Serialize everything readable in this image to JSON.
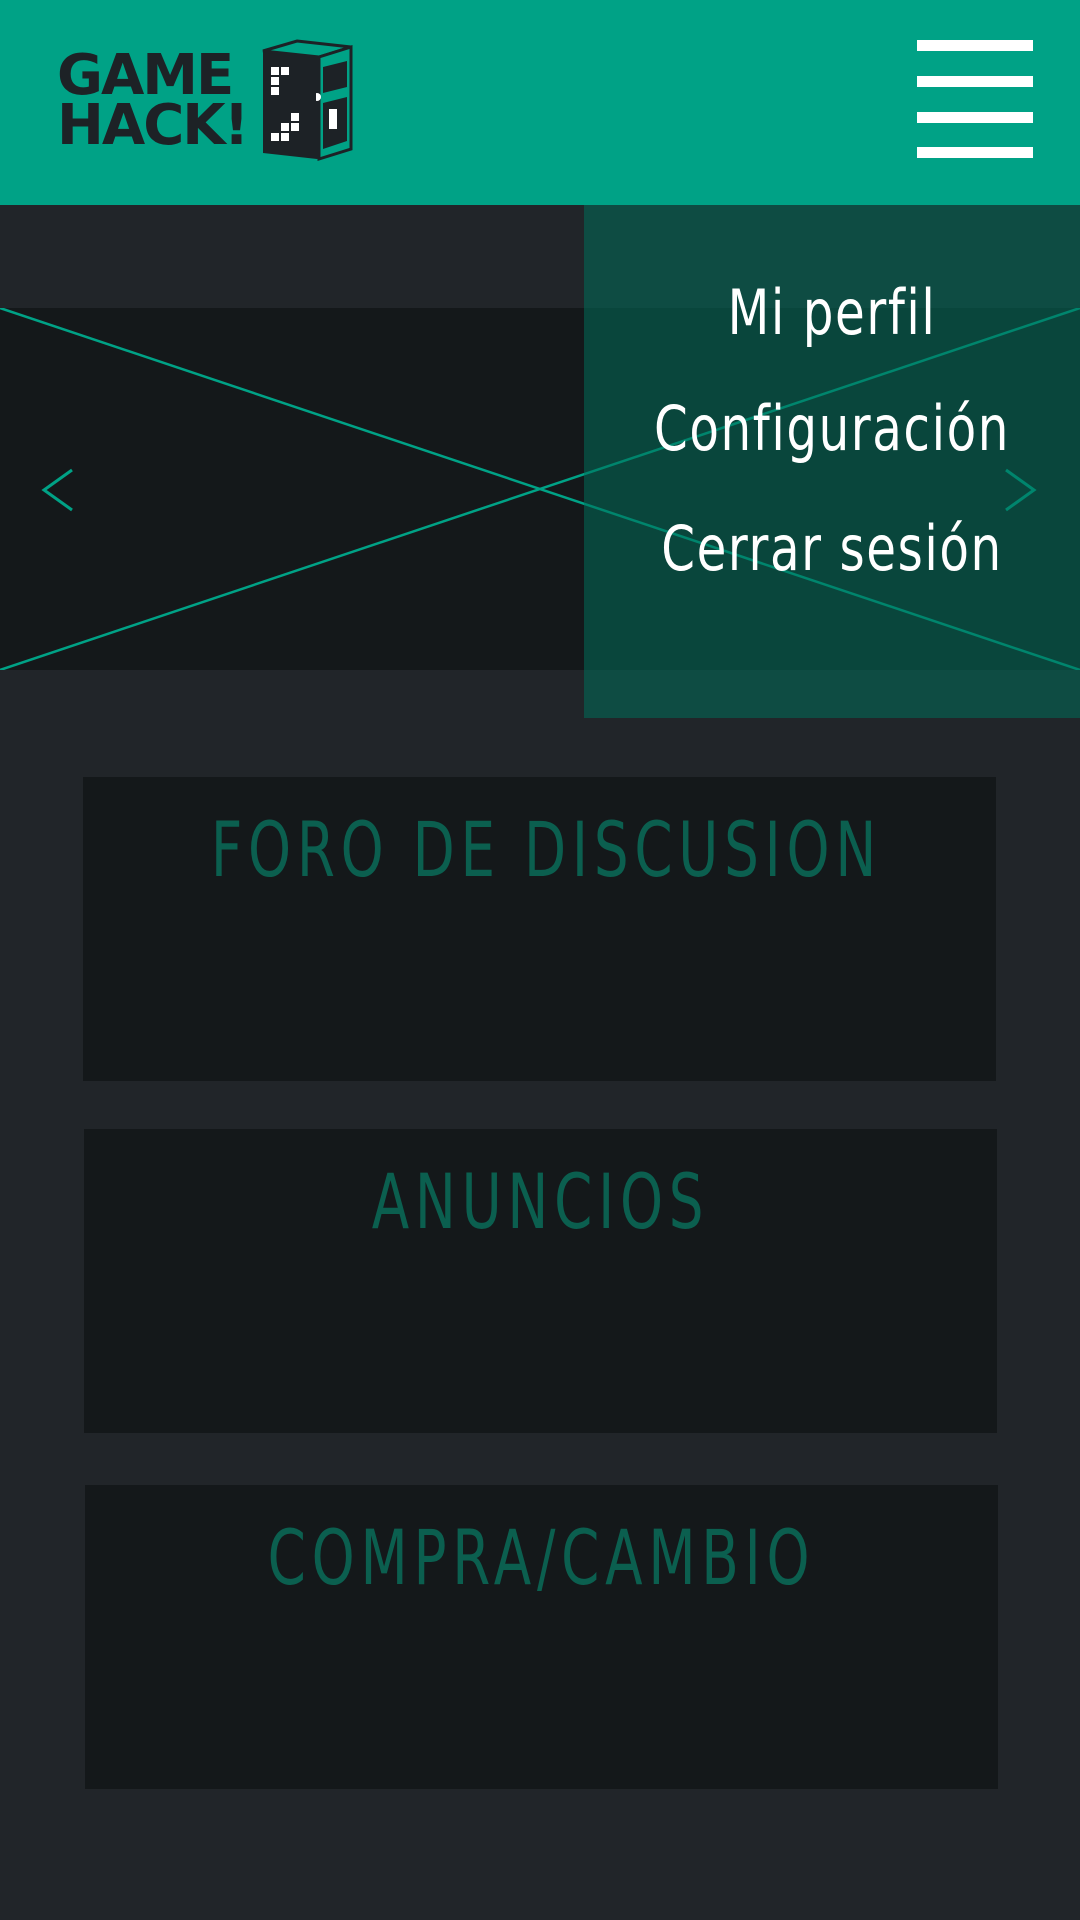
{
  "header": {
    "logo_text": "GAME\nHACK!",
    "menu_icon": "hamburger-menu-icon"
  },
  "carousel": {
    "prev_icon": "chevron-left-icon",
    "next_icon": "chevron-right-icon",
    "placeholder_icon": "image-placeholder-icon"
  },
  "dropdown": {
    "items": [
      {
        "label": "Mi perfil"
      },
      {
        "label": "Configuración"
      },
      {
        "label": "Cerrar sesión"
      }
    ]
  },
  "sections": [
    {
      "title": "FORO DE DISCUSION"
    },
    {
      "title": "ANUNCIOS"
    },
    {
      "title": "COMPRA/CAMBIO"
    }
  ],
  "colors": {
    "header": "#00a286",
    "background": "#212529",
    "panel": "#14181a",
    "accent_text": "#0b5f4f",
    "dropdown": "#0f5a4d"
  }
}
